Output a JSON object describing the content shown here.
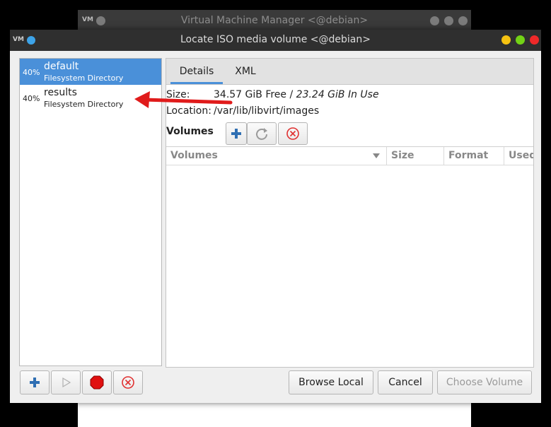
{
  "background_window": {
    "title": "Virtual Machine Manager <@debian>"
  },
  "dialog": {
    "title": "Locate ISO media volume <@debian>",
    "window_controls": [
      "minimize",
      "maximize",
      "close"
    ],
    "colors": {
      "minimize": "#f5c211",
      "maximize": "#73d216",
      "close": "#ef2929"
    }
  },
  "pools": [
    {
      "percent": "40%",
      "name": "default",
      "type": "Filesystem Directory",
      "selected": true
    },
    {
      "percent": "40%",
      "name": "results",
      "type": "Filesystem Directory",
      "selected": false
    }
  ],
  "pool_buttons": [
    {
      "name": "add-pool",
      "icon": "plus-icon"
    },
    {
      "name": "start-pool",
      "icon": "play-icon"
    },
    {
      "name": "stop-pool",
      "icon": "stop-icon"
    },
    {
      "name": "delete-pool",
      "icon": "delete-icon"
    }
  ],
  "tabs": [
    {
      "label": "Details",
      "active": true
    },
    {
      "label": "XML",
      "active": false
    }
  ],
  "details": {
    "size_label": "Size:",
    "size_free": "34.57 GiB Free",
    "size_sep": " / ",
    "size_used": "23.24 GiB In Use",
    "location_label": "Location:",
    "location_value": "/var/lib/libvirt/images",
    "volumes_label": "Volumes"
  },
  "volume_table": {
    "columns": [
      "Volumes",
      "Size",
      "Format",
      "Used"
    ],
    "rows": []
  },
  "footer": {
    "browse_local": "Browse Local",
    "cancel": "Cancel",
    "choose_volume": "Choose Volume"
  },
  "accent_color": "#4a90d9",
  "annotation_color": "#e01b1b"
}
